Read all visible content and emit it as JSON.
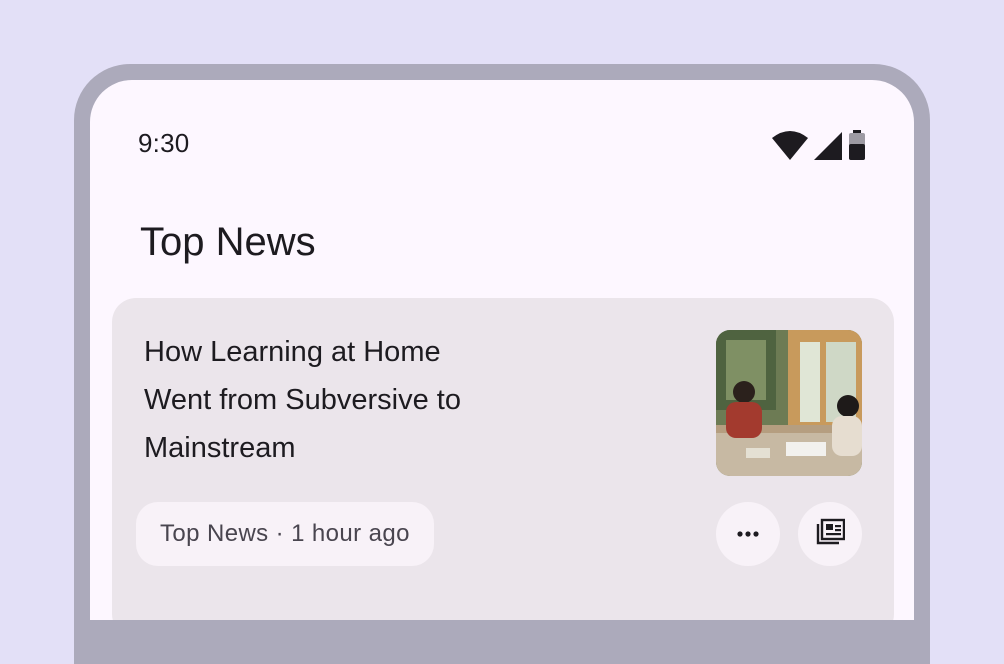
{
  "status_bar": {
    "time": "9:30",
    "icons": [
      "wifi-icon",
      "signal-icon",
      "battery-icon"
    ]
  },
  "page": {
    "title": "Top News"
  },
  "card": {
    "headline": "How Learning at Home Went from Subversive to Mainstream",
    "meta": "Top News · 1 hour ago",
    "thumbnail": "photo of a woman and child studying at a table",
    "actions": [
      "more-horiz-icon",
      "newspaper-icon"
    ]
  },
  "colors": {
    "background": "#e3e0f7",
    "frame": "#acaabb",
    "screen": "#fdf7ff",
    "card": "#ebe5eb",
    "chip": "#f8f2f8",
    "text_primary": "#1d1b20",
    "text_secondary": "#49454f"
  }
}
